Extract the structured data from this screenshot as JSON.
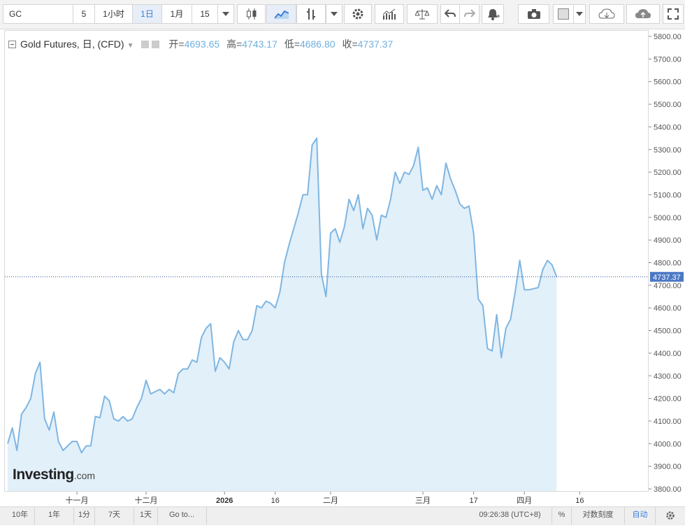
{
  "toolbar": {
    "symbol": "GC",
    "interval_value": "5",
    "interval_1h": "1小时",
    "interval_1d": "1日",
    "interval_1m": "1月",
    "interval_15": "15"
  },
  "legend": {
    "title": "Gold Futures, 日, (CFD)",
    "open_label": "开=",
    "open": "4693.65",
    "high_label": "高=",
    "high": "4743.17",
    "low_label": "低=",
    "low": "4686.80",
    "close_label": "收=",
    "close": "4737.37"
  },
  "watermark": {
    "brand": "Investing",
    "suffix": ".com"
  },
  "bottom": {
    "ranges": [
      "10年",
      "1年",
      "1分",
      "7天",
      "1天"
    ],
    "goto": "Go to...",
    "time": "09:26:38 (UTC+8)",
    "percent": "%",
    "log_scale": "对数刻度",
    "auto": "自动"
  },
  "colors": {
    "line": "#7fb6e2",
    "fill": "#e2f0fa",
    "last_price_bg": "#4a78c4",
    "selected": "#3b7dd8"
  },
  "chart_data": {
    "type": "area",
    "title": "Gold Futures, 日, (CFD)",
    "ylim": [
      3800,
      5800
    ],
    "y_ticks": [
      3800,
      3900,
      4000,
      4100,
      4200,
      4300,
      4400,
      4500,
      4600,
      4700,
      4800,
      4900,
      5000,
      5100,
      5200,
      5300,
      5400,
      5500,
      5600,
      5700,
      5800
    ],
    "y_tick_labels": [
      "3800.00",
      "3900.00",
      "4000.00",
      "4100.00",
      "4200.00",
      "4300.00",
      "4400.00",
      "4500.00",
      "4600.00",
      "4700.00",
      "4800.00",
      "4900.00",
      "5000.00",
      "5100.00",
      "5200.00",
      "5300.00",
      "5400.00",
      "5500.00",
      "5600.00",
      "5700.00",
      "5800.00"
    ],
    "x_ticks": [
      {
        "label": "十一月",
        "index": 15
      },
      {
        "label": "十二月",
        "index": 30
      },
      {
        "label": "2026",
        "index": 47
      },
      {
        "label": "16",
        "index": 58
      },
      {
        "label": "二月",
        "index": 70
      },
      {
        "label": "三月",
        "index": 90
      },
      {
        "label": "17",
        "index": 101
      },
      {
        "label": "四月",
        "index": 112
      },
      {
        "label": "16",
        "index": 124
      }
    ],
    "last_price": 4737.37,
    "values": [
      4000,
      4070,
      3970,
      4130,
      4160,
      4200,
      4310,
      4360,
      4110,
      4060,
      4140,
      4010,
      3970,
      3990,
      4010,
      4010,
      3960,
      3990,
      3990,
      4120,
      4115,
      4210,
      4190,
      4110,
      4100,
      4120,
      4100,
      4110,
      4160,
      4200,
      4280,
      4220,
      4230,
      4240,
      4220,
      4240,
      4225,
      4310,
      4330,
      4330,
      4370,
      4360,
      4470,
      4510,
      4530,
      4320,
      4380,
      4360,
      4330,
      4450,
      4500,
      4460,
      4460,
      4500,
      4610,
      4600,
      4630,
      4620,
      4600,
      4670,
      4800,
      4880,
      4950,
      5020,
      5100,
      5100,
      5320,
      5350,
      4750,
      4650,
      4930,
      4950,
      4890,
      4960,
      5080,
      5030,
      5100,
      4950,
      5040,
      5010,
      4900,
      5010,
      5000,
      5080,
      5200,
      5150,
      5200,
      5190,
      5230,
      5310,
      5120,
      5130,
      5080,
      5140,
      5100,
      5240,
      5170,
      5120,
      5060,
      5040,
      5050,
      4930,
      4640,
      4610,
      4420,
      4410,
      4570,
      4380,
      4510,
      4550,
      4670,
      4810,
      4680,
      4680,
      4685,
      4690,
      4770,
      4810,
      4790,
      4737.37
    ]
  }
}
